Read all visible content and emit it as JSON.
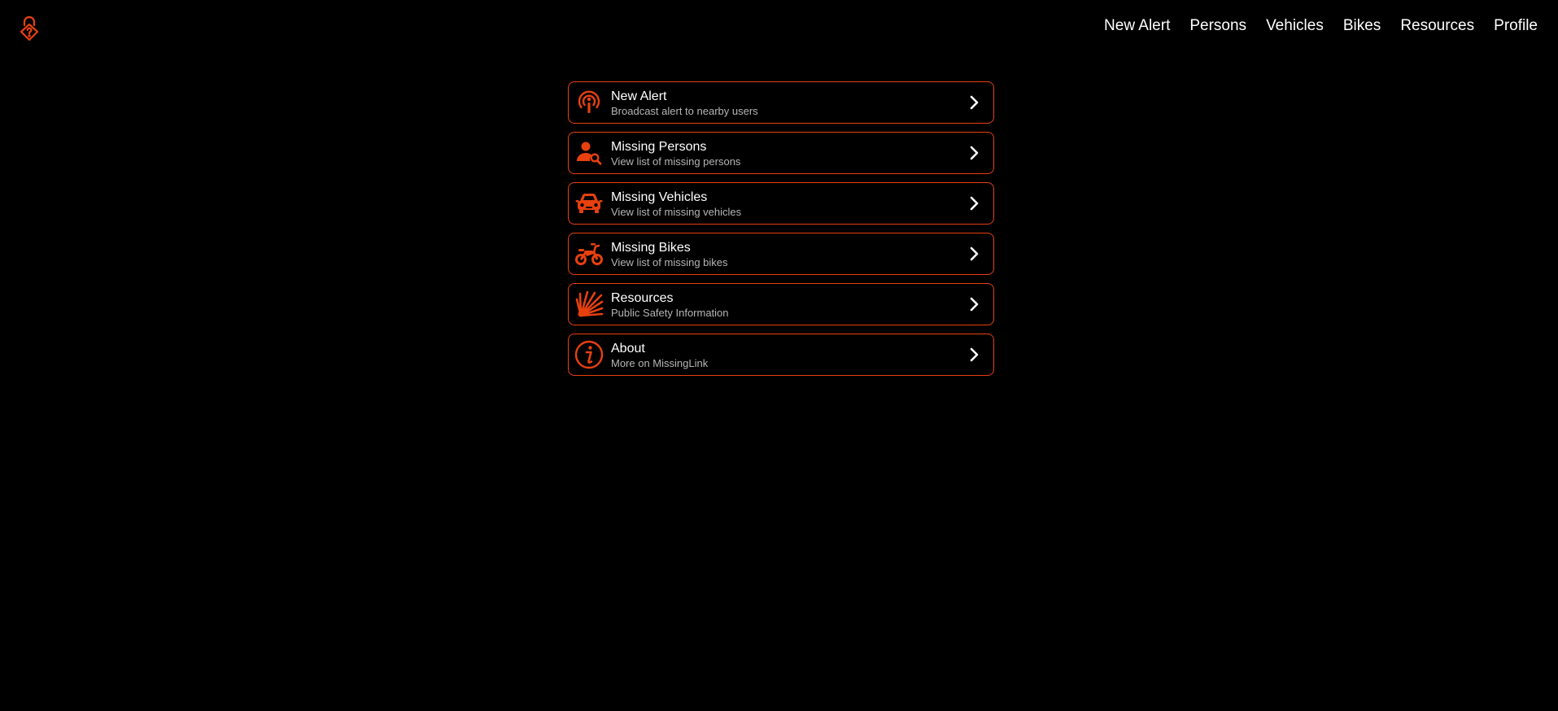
{
  "colors": {
    "accent": "#e8400f",
    "background": "#000000",
    "text": "#ffffff",
    "subtext": "#b5b5b5"
  },
  "header": {
    "logo_icon": "lock-question-icon",
    "nav": [
      {
        "label": "New Alert"
      },
      {
        "label": "Persons"
      },
      {
        "label": "Vehicles"
      },
      {
        "label": "Bikes"
      },
      {
        "label": "Resources"
      },
      {
        "label": "Profile"
      }
    ]
  },
  "menu": [
    {
      "title": "New Alert",
      "subtitle": "Broadcast alert to nearby users",
      "icon": "broadcast-icon"
    },
    {
      "title": "Missing Persons",
      "subtitle": "View list of missing persons",
      "icon": "person-search-icon"
    },
    {
      "title": "Missing Vehicles",
      "subtitle": "View list of missing vehicles",
      "icon": "car-icon"
    },
    {
      "title": "Missing Bikes",
      "subtitle": "View list of missing bikes",
      "icon": "motorbike-icon"
    },
    {
      "title": "Resources",
      "subtitle": "Public Safety Information",
      "icon": "safety-burst-icon"
    },
    {
      "title": "About",
      "subtitle": "More on MissingLink",
      "icon": "info-icon"
    }
  ]
}
